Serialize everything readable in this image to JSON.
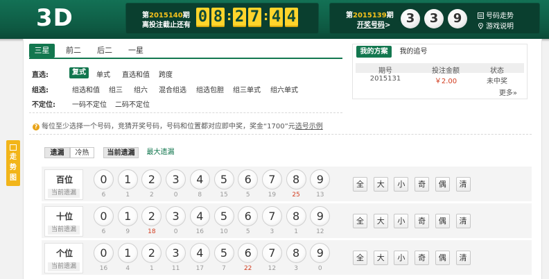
{
  "header": {
    "logo": "3D",
    "countdown": {
      "prefix": "第",
      "issue": "2015140",
      "suffix": "期",
      "line2": "离投注截止还有",
      "digits": [
        "0",
        "8",
        "2",
        "7",
        "4",
        "4"
      ]
    },
    "draw": {
      "prefix": "第",
      "issue": "2015139",
      "suffix": "期",
      "line2": "开奖号码",
      "line2_arrow": ">",
      "balls": [
        "3",
        "3",
        "9"
      ]
    },
    "links": [
      {
        "label": "号码走势",
        "icon": "chart-icon"
      },
      {
        "label": "游戏说明",
        "icon": "location-icon"
      }
    ]
  },
  "tabs": [
    "三星",
    "前二",
    "后二",
    "一星"
  ],
  "play": {
    "rows": [
      {
        "label": "直选:",
        "options": [
          "复式",
          "单式",
          "直选和值",
          "跨度"
        ],
        "selected": 0
      },
      {
        "label": "组选:",
        "options": [
          "组选和值",
          "组三",
          "组六",
          "混合组选",
          "组选包胆",
          "组三单式",
          "组六单式"
        ]
      },
      {
        "label": "不定位:",
        "options": [
          "一码不定位",
          "二码不定位"
        ]
      }
    ],
    "hint_text": "每位至少选择一个号码，竞猜开奖号码，号码和位置都对应即中奖，奖金“1700”元",
    "hint_link": "选号示例"
  },
  "plan": {
    "tabs": [
      "我的方案",
      "我的追号"
    ],
    "headers": [
      "期号",
      "投注金额",
      "状态"
    ],
    "rows": [
      [
        "2015131",
        "￥2.00",
        "未中奖"
      ]
    ],
    "more": "更多»"
  },
  "side_tab": [
    "走",
    "势",
    "图"
  ],
  "miss": {
    "tabs_left": [
      "遗漏",
      "冷热"
    ],
    "tabs_right": [
      "当前遗漏",
      "最大遗漏"
    ],
    "positions": [
      {
        "name": "百位",
        "sub": "当前遗漏",
        "misses": [
          "6",
          "1",
          "2",
          "0",
          "8",
          "15",
          "5",
          "19",
          "25",
          "13"
        ],
        "hot": 8
      },
      {
        "name": "十位",
        "sub": "当前遗漏",
        "misses": [
          "6",
          "9",
          "18",
          "0",
          "16",
          "10",
          "5",
          "3",
          "1",
          "12"
        ],
        "hot": 2
      },
      {
        "name": "个位",
        "sub": "当前遗漏",
        "misses": [
          "16",
          "4",
          "1",
          "11",
          "17",
          "7",
          "22",
          "12",
          "3",
          "0"
        ],
        "hot": 6
      }
    ],
    "numbers": [
      "0",
      "1",
      "2",
      "3",
      "4",
      "5",
      "6",
      "7",
      "8",
      "9"
    ],
    "quick": [
      "全",
      "大",
      "小",
      "奇",
      "偶",
      "清"
    ]
  },
  "colors": {
    "header_green": "#0e5a43",
    "accent_green": "#13774f",
    "digit_yellow": "#ffd42b",
    "highlight": "#f6c11c",
    "hot_red": "#d23c1f",
    "side_tab": "#f2b51a"
  }
}
